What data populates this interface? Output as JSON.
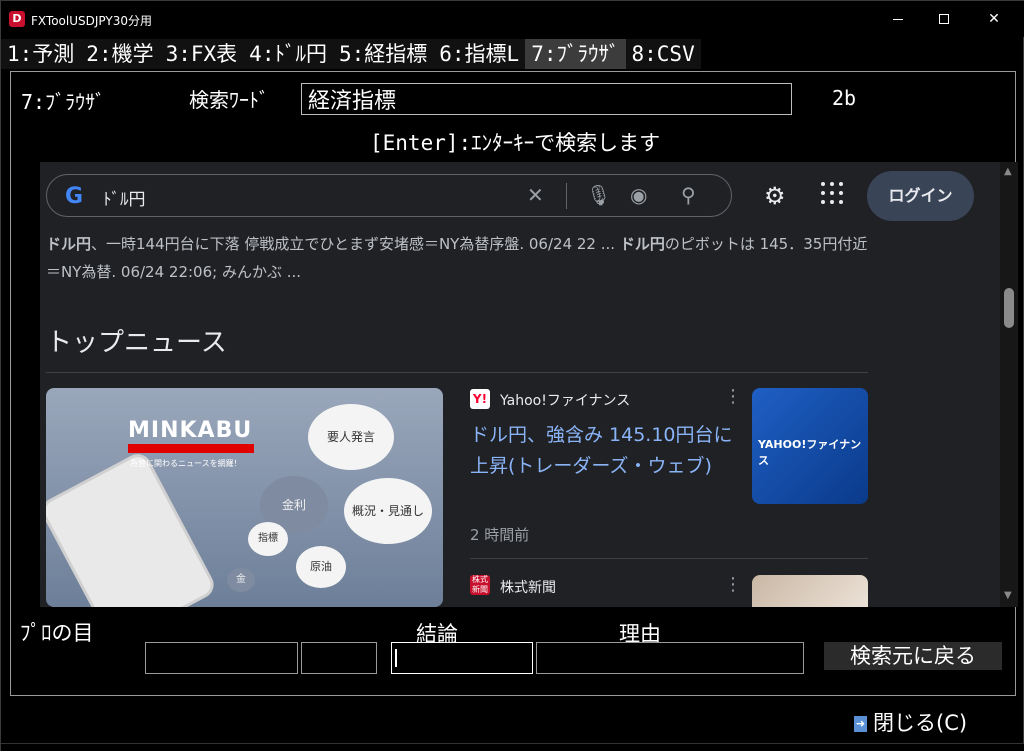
{
  "window": {
    "title": "FXToolUSDJPY30分用",
    "icon_letter": "D",
    "controls": {
      "minimize": "—",
      "maximize": "☐",
      "close": "✕"
    }
  },
  "tabs": [
    {
      "label": "1:予測"
    },
    {
      "label": "2:機学"
    },
    {
      "label": "3:FX表"
    },
    {
      "label": "4:ﾄﾞﾙ円"
    },
    {
      "label": "5:経指標"
    },
    {
      "label": "6:指標L"
    },
    {
      "label": "7:ﾌﾞﾗｳｻﾞ",
      "active": true
    },
    {
      "label": "8:CSV"
    }
  ],
  "panel": {
    "label": "7:ﾌﾞﾗｳｻﾞ",
    "search_label": "検索ﾜｰﾄﾞ",
    "search_value": "経済指標",
    "code": "2b",
    "hint": "[Enter]:ｴﾝﾀｰｷｰで検索します"
  },
  "browser": {
    "logo": "G",
    "query": "ﾄﾞﾙ円",
    "login": "ログイン",
    "snippet_bold_1": "ドル円",
    "snippet_text_1": "、一時144円台に下落 停戦成立でひとまず安堵感＝NY為替序盤. 06/24 22 ... ",
    "snippet_bold_2": "ドル円",
    "snippet_text_2": "のピボットは 145．35円付近＝NY為替. 06/24 22:06; みんかぶ ...",
    "top_news_title": "トップニュース",
    "card1": {
      "logo": "MINKABU",
      "subtitle": "為替に関わるニュースを網羅！",
      "bubbles": [
        "要人発言",
        "金利",
        "概況・見通し",
        "指標",
        "原油",
        "金"
      ]
    },
    "news1": {
      "badge": "Y!",
      "source": "Yahoo!ファイナンス",
      "headline": "ドル円、強含み 145.10円台に上昇(トレーダーズ・ウェブ)",
      "thumb_text": "YAHOO!ファイナンス",
      "time": "2 時間前"
    },
    "news2": {
      "badge": "株式新聞",
      "source": "株式新聞"
    }
  },
  "bottom": {
    "pro_label": "ﾌﾟﾛの目",
    "conclusion_label": "結論",
    "reason_label": "理由",
    "back_button": "検索元に戻る",
    "close_button": "閉じる(C)"
  }
}
